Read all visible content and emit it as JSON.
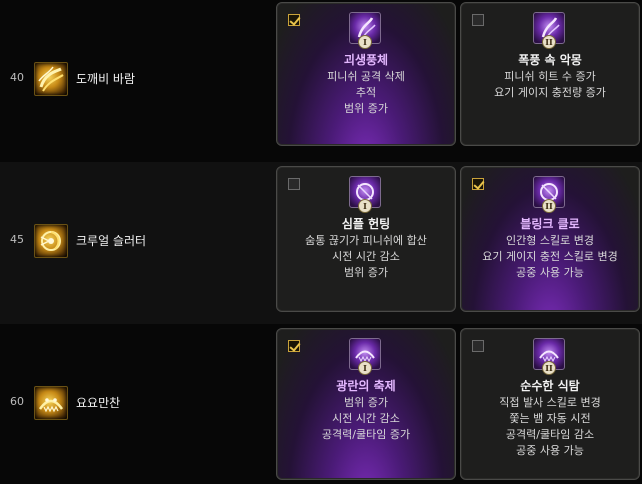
{
  "rows": [
    {
      "level": "40",
      "skill": "도깨비 바람",
      "talents": [
        {
          "numeral": "I",
          "title": "괴생풍체",
          "selected": true,
          "lines": [
            "피니쉬 공격 삭제",
            "추적",
            "범위 증가"
          ]
        },
        {
          "numeral": "II",
          "title": "폭풍 속 악몽",
          "selected": false,
          "lines": [
            "피니쉬 히트 수 증가",
            "요기 게이지 충전량 증가"
          ]
        }
      ]
    },
    {
      "level": "45",
      "skill": "크루얼 슬러터",
      "talents": [
        {
          "numeral": "I",
          "title": "심플 헌팅",
          "selected": false,
          "lines": [
            "숨통 끊기가 피니쉬에 합산",
            "시전 시간 감소",
            "범위 증가"
          ]
        },
        {
          "numeral": "II",
          "title": "블링크 클로",
          "selected": true,
          "lines": [
            "인간형 스킬로 변경",
            "요기 게이지 충전 스킬로 변경",
            "공중 사용 가능"
          ]
        }
      ]
    },
    {
      "level": "60",
      "skill": "요요만찬",
      "talents": [
        {
          "numeral": "I",
          "title": "광란의 축제",
          "selected": true,
          "lines": [
            "범위 증가",
            "시전 시간 감소",
            "공격력/쿨타임 증가"
          ]
        },
        {
          "numeral": "II",
          "title": "순수한 식탐",
          "selected": false,
          "lines": [
            "직접 발사 스킬로 변경",
            "쫓는 뱀 자동 시전",
            "공격력/쿨타임 감소",
            "공중 사용 가능"
          ]
        }
      ]
    }
  ],
  "colors": {
    "selected_title": "#e4b8ff",
    "unselected_title": "#f2f2f2",
    "check_accent": "#e8c34c",
    "selected_glow": "#7a2cb8"
  },
  "icons": [
    "wind-swirl-icon",
    "claw-vortex-icon",
    "feast-mouth-icon",
    "talent-purple-icon",
    "checkbox-icon"
  ]
}
